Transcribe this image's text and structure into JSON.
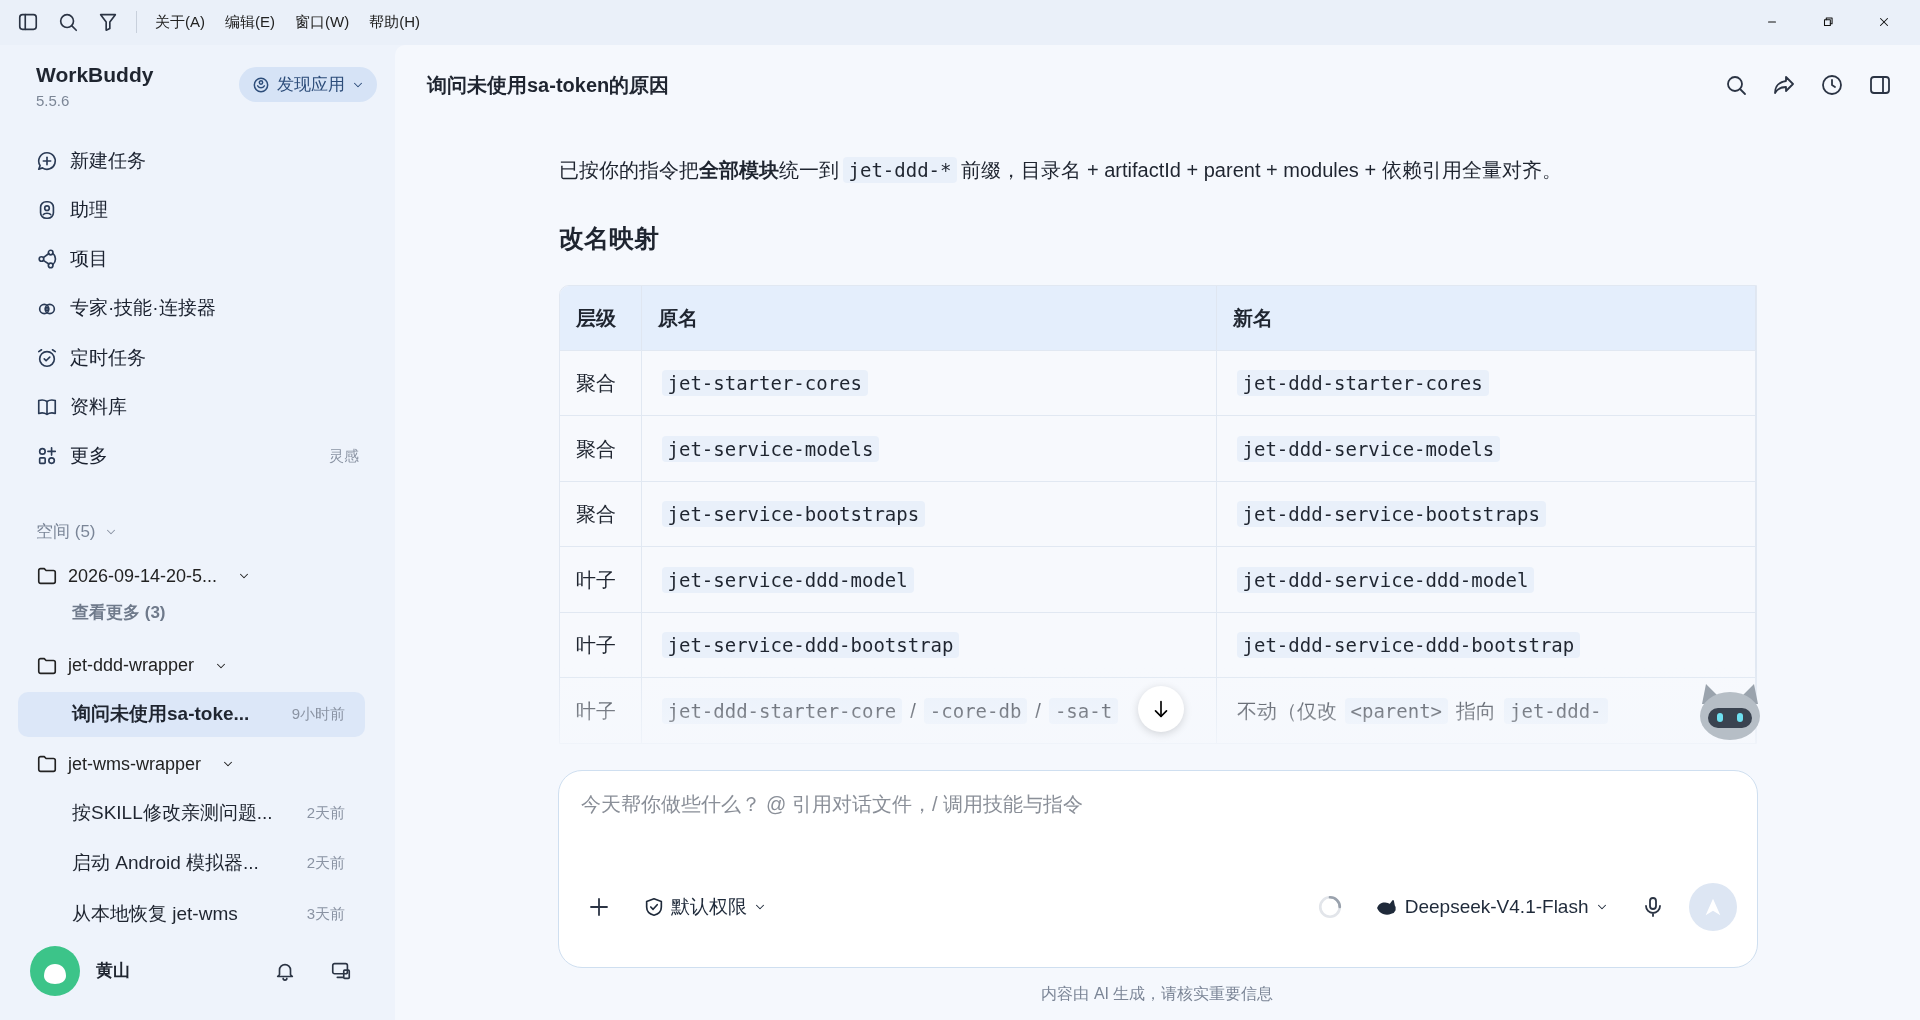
{
  "menubar": {
    "menus": [
      "关于(A)",
      "编辑(E)",
      "窗口(W)",
      "帮助(H)"
    ]
  },
  "app": {
    "name": "WorkBuddy",
    "version": "5.5.6",
    "discover_button": "发现应用"
  },
  "sidebar": {
    "items": [
      {
        "label": "新建任务"
      },
      {
        "label": "助理"
      },
      {
        "label": "项目"
      },
      {
        "label": "专家·技能·连接器"
      },
      {
        "label": "定时任务"
      },
      {
        "label": "资料库"
      },
      {
        "label": "更多",
        "note": "灵感"
      }
    ],
    "spaces_header": "空间 (5)",
    "spaces": [
      {
        "name": "2026-09-14-20-5...",
        "more": "查看更多 (3)"
      },
      {
        "name": "jet-ddd-wrapper",
        "tasks": [
          {
            "title": "询问未使用sa-toke...",
            "time": "9小时前",
            "selected": true
          }
        ]
      },
      {
        "name": "jet-wms-wrapper",
        "tasks": [
          {
            "title": "按SKILL修改亲测问题...",
            "time": "2天前",
            "selected": false
          },
          {
            "title": "启动 Android 模拟器...",
            "time": "2天前",
            "selected": false
          },
          {
            "title": "从本地恢复 jet-wms",
            "time": "3天前",
            "selected": false
          }
        ]
      }
    ],
    "user": {
      "name": "黄山"
    }
  },
  "chat": {
    "title": "询问未使用sa-token的原因",
    "intro": [
      {
        "kind": "text",
        "text": "已按你的指令把**全部模块**统一到"
      },
      {
        "kind": "code",
        "text": "jet-ddd-*"
      },
      {
        "kind": "text",
        "text": "前缀，目录名 + artifactId + parent + modules + 依赖引用全量对齐。"
      }
    ],
    "heading": "改名映射",
    "table": {
      "columns": [
        "层级",
        "原名",
        "新名"
      ],
      "rows": [
        [
          [
            {
              "kind": "text",
              "text": "聚合"
            }
          ],
          [
            {
              "kind": "code",
              "text": "jet-starter-cores"
            }
          ],
          [
            {
              "kind": "code",
              "text": "jet-ddd-starter-cores"
            }
          ]
        ],
        [
          [
            {
              "kind": "text",
              "text": "聚合"
            }
          ],
          [
            {
              "kind": "code",
              "text": "jet-service-models"
            }
          ],
          [
            {
              "kind": "code",
              "text": "jet-ddd-service-models"
            }
          ]
        ],
        [
          [
            {
              "kind": "text",
              "text": "聚合"
            }
          ],
          [
            {
              "kind": "code",
              "text": "jet-service-bootstraps"
            }
          ],
          [
            {
              "kind": "code",
              "text": "jet-ddd-service-bootstraps"
            }
          ]
        ],
        [
          [
            {
              "kind": "text",
              "text": "叶子"
            }
          ],
          [
            {
              "kind": "code",
              "text": "jet-service-ddd-model"
            }
          ],
          [
            {
              "kind": "code",
              "text": "jet-ddd-service-ddd-model"
            }
          ]
        ],
        [
          [
            {
              "kind": "text",
              "text": "叶子"
            }
          ],
          [
            {
              "kind": "code",
              "text": "jet-service-ddd-bootstrap"
            }
          ],
          [
            {
              "kind": "code",
              "text": "jet-ddd-service-ddd-bootstrap"
            }
          ]
        ],
        [
          [
            {
              "kind": "text",
              "text": "叶子"
            }
          ],
          [
            {
              "kind": "code",
              "text": "jet-ddd-starter-core"
            },
            {
              "kind": "text",
              "text": "/"
            },
            {
              "kind": "code",
              "text": "-core-db"
            },
            {
              "kind": "text",
              "text": "/"
            },
            {
              "kind": "code",
              "text": "-sa-t"
            }
          ],
          [
            {
              "kind": "text",
              "text": "不动（仅改"
            },
            {
              "kind": "code",
              "text": "<parent>"
            },
            {
              "kind": "text",
              "text": "指向"
            },
            {
              "kind": "code",
              "text": "jet-ddd-"
            }
          ]
        ]
      ]
    }
  },
  "composer": {
    "placeholder": "今天帮你做些什么？ @ 引用对话文件，/ 调用技能与指令",
    "permission": "默认权限",
    "model": "Deepseek-V4.1-Flash"
  },
  "disclaimer": "内容由 AI 生成，请核实重要信息"
}
